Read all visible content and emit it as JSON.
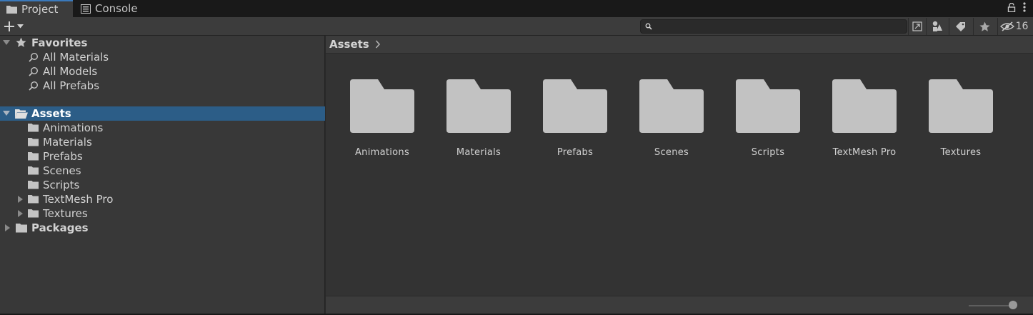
{
  "tabs": [
    {
      "label": "Project",
      "icon": "folder-icon",
      "active": true
    },
    {
      "label": "Console",
      "icon": "console-icon",
      "active": false
    }
  ],
  "toolbar": {
    "search_value": "",
    "hidden_count": "16"
  },
  "favorites": {
    "label": "Favorites",
    "items": [
      "All Materials",
      "All Models",
      "All Prefabs"
    ]
  },
  "tree": {
    "assets_label": "Assets",
    "children": [
      "Animations",
      "Materials",
      "Prefabs",
      "Scenes",
      "Scripts",
      "TextMesh Pro",
      "Textures"
    ],
    "packages_label": "Packages"
  },
  "breadcrumb": {
    "path": "Assets"
  },
  "grid": {
    "items": [
      "Animations",
      "Materials",
      "Prefabs",
      "Scenes",
      "Scripts",
      "TextMesh Pro",
      "Textures"
    ]
  },
  "colors": {
    "selection": "#2c5d87",
    "folder": "#c2c2c2",
    "accent_tab": "#3a79bb"
  }
}
